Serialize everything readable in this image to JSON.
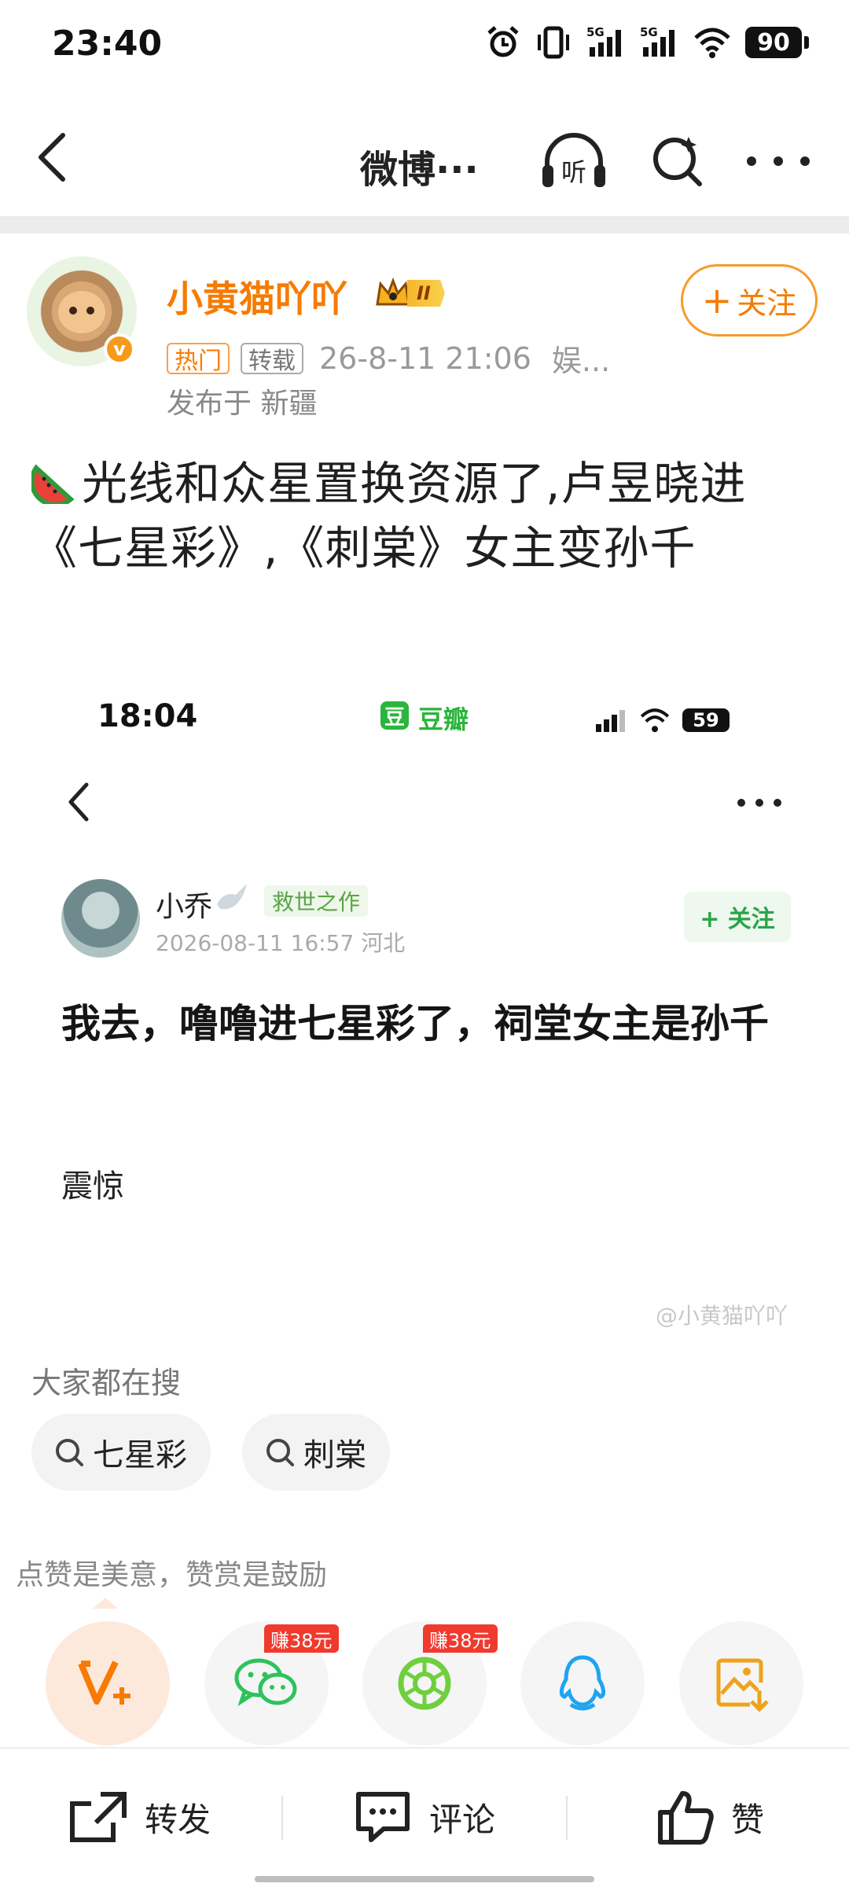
{
  "status_bar": {
    "time": "23:40",
    "battery": "90",
    "network_1": "5G",
    "network_2": "5G",
    "icons": [
      "alarm-icon",
      "vibrate-icon",
      "signal-icon",
      "signal-icon",
      "wifi-icon",
      "battery-icon"
    ]
  },
  "header": {
    "title": "微博···",
    "listen_label": "听",
    "icons": [
      "back-icon",
      "listen-icon",
      "search-icon",
      "more-icon"
    ]
  },
  "author": {
    "name": "小黄猫吖吖",
    "verified_mark": "v",
    "vip_level": "II",
    "follow_label": "关注",
    "tags": [
      "热门",
      "转载"
    ],
    "time": "26-8-11 21:06",
    "source": "娱...",
    "location": "发布于 新疆"
  },
  "post": {
    "text": "光线和众星置换资源了,卢昱晓进《七星彩》,《刺棠》女主变孙千"
  },
  "embedded_screenshot": {
    "time": "18:04",
    "app_logo": "豆",
    "app_name": "豆瓣",
    "battery": "59",
    "user": "小乔",
    "user_tag": "救世之作",
    "follow_label": "+ 关注",
    "date": "2026-08-11 16:57 河北",
    "title": "我去，噜噜进七星彩了，祠堂女主是孙千",
    "body": "震惊",
    "watermark": "@小黄猫吖吖"
  },
  "hot_search": {
    "heading": "大家都在搜",
    "items": [
      "七星彩",
      "刺棠"
    ]
  },
  "share": {
    "prompt": "点赞是美意，赞赏是鼓励",
    "earn_label_1": "赚38元",
    "earn_label_2": "赚38元",
    "icons": [
      "reward-icon",
      "wechat-icon",
      "moments-icon",
      "qq-icon",
      "save-image-icon"
    ]
  },
  "actions": {
    "repost": "转发",
    "comment": "评论",
    "like": "赞"
  },
  "colors": {
    "accent": "#f77b00",
    "wechat": "#2dc35b",
    "qq": "#1fa4f0",
    "douban": "#2ab53c"
  }
}
